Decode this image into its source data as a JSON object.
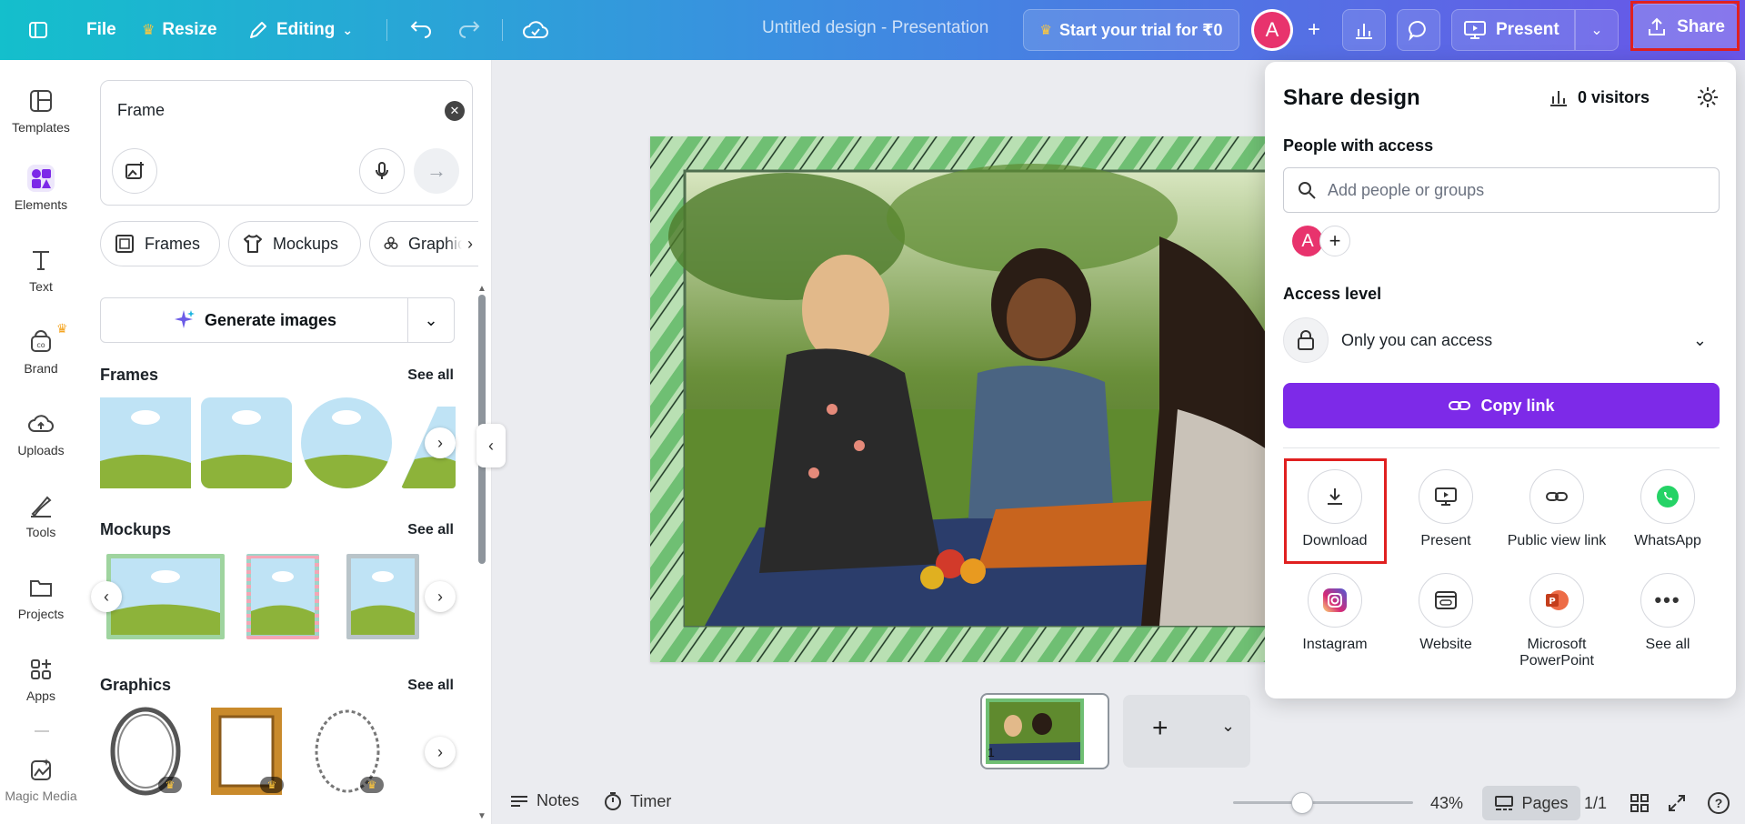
{
  "topbar": {
    "file_label": "File",
    "resize_label": "Resize",
    "editing_label": "Editing",
    "design_title": "Untitled design - Presentation",
    "trial_label": "Start your trial for ₹0",
    "avatar_letter": "A",
    "present_label": "Present",
    "share_label": "Share"
  },
  "rail": {
    "items": [
      {
        "label": "Templates",
        "icon": "templates-icon"
      },
      {
        "label": "Elements",
        "icon": "elements-icon"
      },
      {
        "label": "Text",
        "icon": "text-icon"
      },
      {
        "label": "Brand",
        "icon": "brand-icon"
      },
      {
        "label": "Uploads",
        "icon": "uploads-icon"
      },
      {
        "label": "Tools",
        "icon": "tools-icon"
      },
      {
        "label": "Projects",
        "icon": "projects-icon"
      },
      {
        "label": "Apps",
        "icon": "apps-icon"
      },
      {
        "label": "Magic Media",
        "icon": "magic-media-icon"
      }
    ]
  },
  "panel": {
    "search_value": "Frame",
    "chips": [
      "Frames",
      "Mockups",
      "Graphic"
    ],
    "generate_label": "Generate images",
    "sections": [
      {
        "title": "Frames",
        "see_all": "See all"
      },
      {
        "title": "Mockups",
        "see_all": "See all"
      },
      {
        "title": "Graphics",
        "see_all": "See all"
      }
    ]
  },
  "pages": {
    "page_number": "1"
  },
  "bottombar": {
    "notes_label": "Notes",
    "timer_label": "Timer",
    "zoom": "43%",
    "pages_label": "Pages",
    "page_count": "1/1"
  },
  "share": {
    "title": "Share design",
    "visitors": "0 visitors",
    "people_label": "People with access",
    "add_placeholder": "Add people or groups",
    "avatar_letter": "A",
    "access_label": "Access level",
    "access_value": "Only you can access",
    "copy_link_label": "Copy link",
    "options": [
      {
        "label": "Download",
        "icon": "download-icon"
      },
      {
        "label": "Present",
        "icon": "present-icon"
      },
      {
        "label": "Public view link",
        "icon": "link-icon"
      },
      {
        "label": "WhatsApp",
        "icon": "whatsapp-icon"
      },
      {
        "label": "Instagram",
        "icon": "instagram-icon"
      },
      {
        "label": "Website",
        "icon": "website-icon"
      },
      {
        "label": "Microsoft PowerPoint",
        "icon": "powerpoint-icon"
      },
      {
        "label": "See all",
        "icon": "more-icon"
      }
    ]
  },
  "colors": {
    "accent_purple": "#7d2ae8",
    "highlight_red": "#e02020",
    "avatar_pink": "#e8336d"
  }
}
